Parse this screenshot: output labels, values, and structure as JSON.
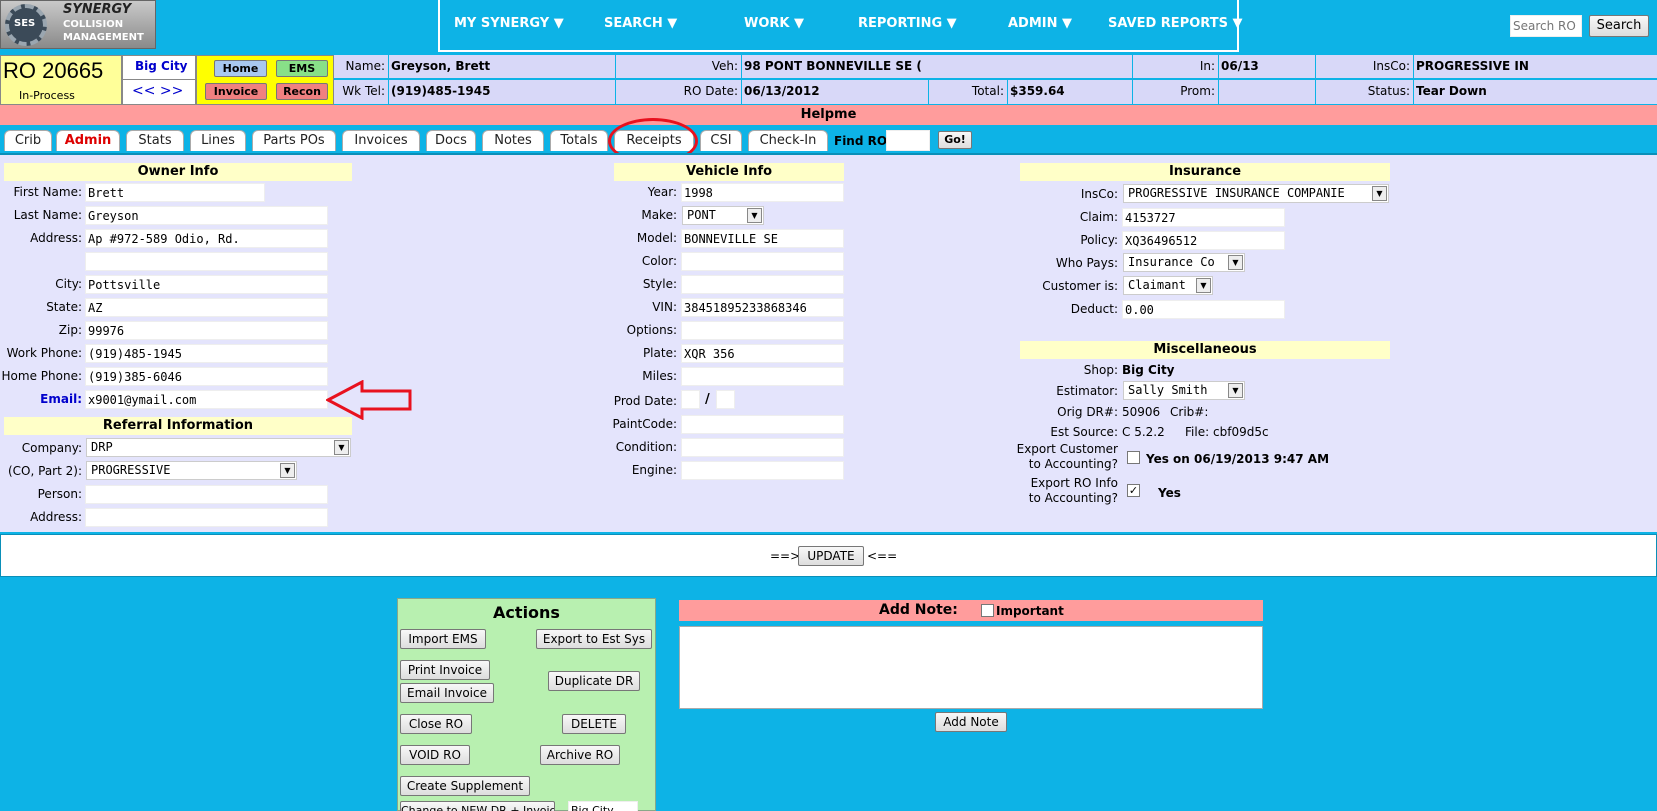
{
  "logo": {
    "abbr": "SES",
    "line1": "SYNERGY",
    "line2": "COLLISION",
    "line3": "MANAGEMENT"
  },
  "nav": {
    "items": [
      "MY SYNERGY ▼",
      "SEARCH ▼",
      "WORK ▼",
      "REPORTING ▼",
      "ADMIN ▼",
      "SAVED REPORTS ▼"
    ],
    "search_placeholder": "Search RO",
    "search_button": "Search"
  },
  "ro": {
    "number": "RO 20665",
    "status": "In-Process",
    "location": "Big City",
    "nav_arrows": "<< >>"
  },
  "quick": {
    "home": "Home",
    "ems": "EMS",
    "invoice": "Invoice",
    "recon": "Recon"
  },
  "summary": {
    "name_label": "Name:",
    "name": "Greyson, Brett",
    "veh_label": "Veh:",
    "veh": "98 PONT BONNEVILLE SE (",
    "in_label": "In:",
    "in": "06/13",
    "insco_label": "InsCo:",
    "insco": "PROGRESSIVE IN",
    "wktel_label": "Wk Tel:",
    "wktel": "(919)485-1945",
    "rodate_label": "RO Date:",
    "rodate": "06/13/2012",
    "total_label": "Total:",
    "total": "$359.64",
    "prom_label": "Prom:",
    "prom": "",
    "status_label": "Status:",
    "status": "Tear Down"
  },
  "helpme": "Helpme",
  "tabs": [
    "Crib",
    "Admin",
    "Stats",
    "Lines",
    "Parts POs",
    "Invoices",
    "Docs",
    "Notes",
    "Totals",
    "Receipts",
    "CSI",
    "Check-In"
  ],
  "find_ro": {
    "label": "Find RO:",
    "value": "",
    "go": "Go!"
  },
  "owner": {
    "title": "Owner Info",
    "first_label": "First Name:",
    "first": "Brett",
    "last_label": "Last Name:",
    "last": "Greyson",
    "addr_label": "Address:",
    "addr1": "Ap #972-589 Odio, Rd.",
    "addr2": "",
    "city_label": "City:",
    "city": "Pottsville",
    "state_label": "State:",
    "state": "AZ",
    "zip_label": "Zip:",
    "zip": "99976",
    "work_label": "Work Phone:",
    "work": "(919)485-1945",
    "home_label": "Home Phone:",
    "home": "(919)385-6046",
    "email_label": "Email:",
    "email": "x9001@ymail.com"
  },
  "referral": {
    "title": "Referral Information",
    "company_label": "Company:",
    "company": "DRP",
    "co2_label": "(CO, Part 2):",
    "co2": "PROGRESSIVE",
    "person_label": "Person:",
    "person": "",
    "address_label": "Address:",
    "address": ""
  },
  "vehicle": {
    "title": "Vehicle Info",
    "year_label": "Year:",
    "year": "1998",
    "make_label": "Make:",
    "make": "PONT",
    "model_label": "Model:",
    "model": "BONNEVILLE SE",
    "color_label": "Color:",
    "color": "",
    "style_label": "Style:",
    "style": "",
    "vin_label": "VIN:",
    "vin": "38451895233868346",
    "options_label": "Options:",
    "options": "",
    "plate_label": "Plate:",
    "plate": "XQR 356",
    "miles_label": "Miles:",
    "miles": "",
    "prod_label": "Prod Date:",
    "prod_sep": "/",
    "paint_label": "PaintCode:",
    "paint": "",
    "cond_label": "Condition:",
    "cond": "",
    "engine_label": "Engine:",
    "engine": ""
  },
  "insurance": {
    "title": "Insurance",
    "insco_label": "InsCo:",
    "insco": "PROGRESSIVE INSURANCE COMPANIE",
    "claim_label": "Claim:",
    "claim": "4153727",
    "policy_label": "Policy:",
    "policy": "XQ36496512",
    "who_label": "Who Pays:",
    "who": "Insurance Co",
    "cust_label": "Customer is:",
    "cust": "Claimant",
    "deduct_label": "Deduct:",
    "deduct": "0.00"
  },
  "misc": {
    "title": "Miscellaneous",
    "shop_label": "Shop:",
    "shop": "Big City",
    "est_label": "Estimator:",
    "est": "Sally Smith",
    "orig_label": "Orig DR#:",
    "orig": "50906",
    "crib_label": "Crib#:",
    "src_label": "Est Source:",
    "src": "C 5.2.2",
    "file_label": "File:",
    "file": "cbf09d5c",
    "exp_cust_label1": "Export Customer",
    "exp_cust_label2": "to Accounting?",
    "exp_cust_value": "Yes on 06/19/2013 9:47 AM",
    "exp_ro_label1": "Export RO Info",
    "exp_ro_label2": "to Accounting?",
    "exp_ro_value": "Yes"
  },
  "update": {
    "left": "==>",
    "button": "UPDATE",
    "right": "<=="
  },
  "actions": {
    "title": "Actions",
    "import_ems": "Import EMS",
    "export_est": "Export to Est Sys",
    "print_invoice": "Print Invoice",
    "email_invoice": "Email Invoice",
    "duplicate_dr": "Duplicate DR",
    "close_ro": "Close RO",
    "delete": "DELETE",
    "void_ro": "VOID RO",
    "archive_ro": "Archive RO",
    "create_supplement": "Create Supplement",
    "change_new_dr": "Change to NEW DR + Invoice",
    "change_new_value": "Big City"
  },
  "note": {
    "title": "Add Note:",
    "important": "Important",
    "button": "Add Note"
  },
  "colors": {
    "bg": "#0db3e6",
    "panel": "#e4e4fc",
    "header_yellow": "#ffffc8",
    "helpme": "#ff9c9c",
    "annotation_red": "#e8111e"
  }
}
